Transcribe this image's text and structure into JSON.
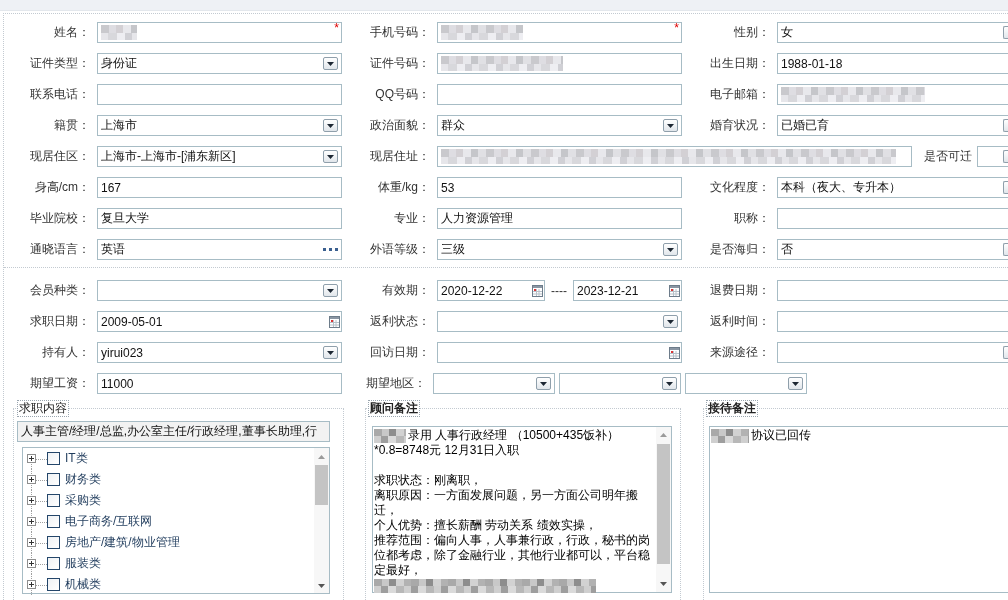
{
  "personal_info": {
    "rows": [
      {
        "kind": "standard",
        "cells": [
          {
            "label": "姓名：",
            "kind": "text",
            "redacted": true,
            "required_mark": "*"
          },
          {
            "label": "手机号码：",
            "kind": "text",
            "redacted": true,
            "required_mark": "*"
          },
          {
            "label": "性别：",
            "kind": "select",
            "redacted": false,
            "value": "女"
          }
        ]
      },
      {
        "kind": "standard",
        "cells": [
          {
            "label": "证件类型：",
            "kind": "select",
            "redacted": false,
            "value": "身份证"
          },
          {
            "label": "证件号码：",
            "kind": "text",
            "redacted": true
          },
          {
            "label": "出生日期：",
            "kind": "text",
            "redacted": false,
            "value": "1988-01-18"
          }
        ]
      },
      {
        "kind": "standard",
        "cells": [
          {
            "label": "联系电话：",
            "kind": "text",
            "redacted": false
          },
          {
            "label": "QQ号码：",
            "kind": "text",
            "redacted": false
          },
          {
            "label": "电子邮箱：",
            "kind": "text",
            "redacted": true
          }
        ]
      },
      {
        "kind": "standard",
        "cells": [
          {
            "label": "籍贯：",
            "kind": "select",
            "redacted": false,
            "value": "上海市"
          },
          {
            "label": "政治面貌：",
            "kind": "select",
            "redacted": false,
            "value": "群众"
          },
          {
            "label": "婚育状况：",
            "kind": "select",
            "redacted": false,
            "value": "已婚已育"
          }
        ]
      },
      {
        "kind": "address",
        "cells": [
          {
            "label": "现居住区：",
            "kind": "select",
            "redacted": false,
            "value": "上海市-上海市-[浦东新区]"
          },
          {
            "label": "现居住址：",
            "kind": "text",
            "redacted": true
          },
          {
            "label": "是否可迁",
            "kind": "select",
            "redacted": false
          }
        ]
      },
      {
        "kind": "standard",
        "cells": [
          {
            "label": "身高/cm：",
            "kind": "text",
            "redacted": false,
            "value": "167"
          },
          {
            "label": "体重/kg：",
            "kind": "text",
            "redacted": false,
            "value": "53"
          },
          {
            "label": "文化程度：",
            "kind": "select",
            "redacted": false,
            "value": "本科（夜大、专升本）"
          }
        ]
      },
      {
        "kind": "standard",
        "cells": [
          {
            "label": "毕业院校：",
            "kind": "text",
            "redacted": false,
            "value": "复旦大学"
          },
          {
            "label": "专业：",
            "kind": "text",
            "redacted": false,
            "value": "人力资源管理"
          },
          {
            "label": "职称：",
            "kind": "text",
            "redacted": false
          }
        ]
      },
      {
        "kind": "standard",
        "cells": [
          {
            "label": "通晓语言：",
            "kind": "lookup",
            "redacted": false,
            "value": "英语"
          },
          {
            "label": "外语等级：",
            "kind": "select",
            "redacted": false,
            "value": "三级"
          },
          {
            "label": "是否海归：",
            "kind": "select",
            "redacted": false,
            "value": "否"
          }
        ]
      }
    ]
  },
  "membership": {
    "rows": [
      {
        "kind": "standard",
        "cells": [
          {
            "label": "会员种类：",
            "kind": "select"
          },
          {
            "label": "有效期：",
            "kind": "date_range",
            "from": "2020-12-22",
            "separator": "----",
            "to": "2023-12-21"
          },
          {
            "label": "退费日期：",
            "kind": "text"
          }
        ]
      },
      {
        "kind": "standard",
        "cells": [
          {
            "label": "求职日期：",
            "kind": "date",
            "value": "2009-05-01"
          },
          {
            "label": "返利状态：",
            "kind": "select"
          },
          {
            "label": "返利时间：",
            "kind": "text"
          }
        ]
      },
      {
        "kind": "standard",
        "cells": [
          {
            "label": "持有人：",
            "kind": "select",
            "value": "yirui023"
          },
          {
            "label": "回访日期：",
            "kind": "date"
          },
          {
            "label": "来源途径：",
            "kind": "select"
          }
        ]
      },
      {
        "kind": "standard",
        "cells": [
          {
            "label": "期望工资：",
            "kind": "text",
            "value": "11000"
          },
          {
            "label": "期望地区：",
            "kind": "select_group",
            "fields": [
              {
                "kind": "select"
              },
              {
                "kind": "select"
              },
              {
                "kind": "select"
              }
            ]
          }
        ]
      }
    ]
  },
  "groups": [
    {
      "kind": "tree",
      "legend": "求职内容",
      "summary": "人事主管/经理/总监,办公室主任/行政经理,董事长助理,行",
      "items": [
        {
          "label": "IT类",
          "expanded": false,
          "checked": false
        },
        {
          "label": "财务类",
          "expanded": false,
          "checked": false
        },
        {
          "label": "采购类",
          "expanded": false,
          "checked": false
        },
        {
          "label": "电子商务/互联网",
          "expanded": false,
          "checked": false
        },
        {
          "label": "房地产/建筑/物业管理",
          "expanded": false,
          "checked": false
        },
        {
          "label": "服装类",
          "expanded": false,
          "checked": false
        },
        {
          "label": "机械类",
          "expanded": false,
          "checked": false
        }
      ]
    },
    {
      "kind": "notes",
      "legend": "顾问备注",
      "lines": [
        {
          "kind": "text",
          "redacted_prefix": true,
          "text": "录用 人事行政经理 （10500+435饭补）"
        },
        {
          "kind": "text",
          "redacted_prefix": false,
          "text": "*0.8=8748元 12月31日入职"
        },
        {
          "kind": "blank"
        },
        {
          "kind": "text",
          "redacted_prefix": false,
          "text": "求职状态：刚离职，"
        },
        {
          "kind": "text",
          "redacted_prefix": false,
          "text": "离职原因：一方面发展问题，另一方面公司明年搬迁，"
        },
        {
          "kind": "text",
          "redacted_prefix": false,
          "text": "个人优势：擅长薪酬 劳动关系 绩效实操，"
        },
        {
          "kind": "text",
          "redacted_prefix": false,
          "text": "推荐范围：偏向人事，人事兼行政，行政，秘书的岗位都考虑，除了金融行业，其他行业都可以，平台稳定最好，"
        }
      ],
      "redacted_tail": true
    },
    {
      "kind": "notes",
      "legend": "接待备注",
      "lines": [
        {
          "kind": "text",
          "redacted_prefix": true,
          "text": "协议已回传"
        }
      ],
      "redacted_tail": false
    }
  ]
}
